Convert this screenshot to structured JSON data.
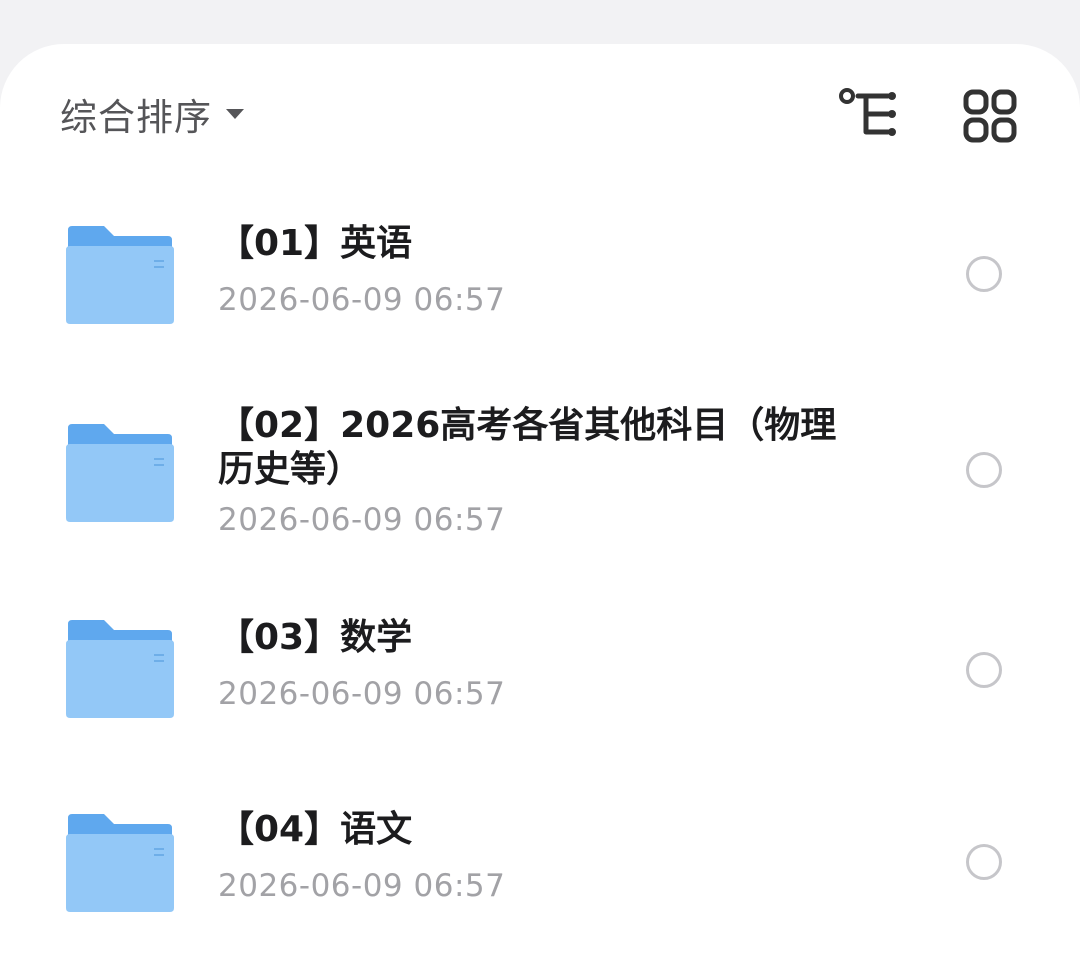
{
  "toolbar": {
    "sort_label": "综合排序",
    "caret_icon": "caret-down-icon",
    "tree_icon": "tree-view-icon",
    "grid_icon": "grid-view-icon"
  },
  "colors": {
    "folder_back": "#5fa8ee",
    "folder_front": "#93c8f7",
    "text_primary": "#1c1c1e",
    "text_secondary": "#a2a2a6"
  },
  "files": [
    {
      "title": "【01】英语",
      "date": "2026-06-09 06:57",
      "icon": "folder-icon",
      "selected": false
    },
    {
      "title": "【02】2026高考各省其他科目（物理历史等）",
      "date": "2026-06-09 06:57",
      "icon": "folder-icon",
      "selected": false
    },
    {
      "title": "【03】数学",
      "date": "2026-06-09 06:57",
      "icon": "folder-icon",
      "selected": false
    },
    {
      "title": "【04】语文",
      "date": "2026-06-09 06:57",
      "icon": "folder-icon",
      "selected": false
    }
  ]
}
